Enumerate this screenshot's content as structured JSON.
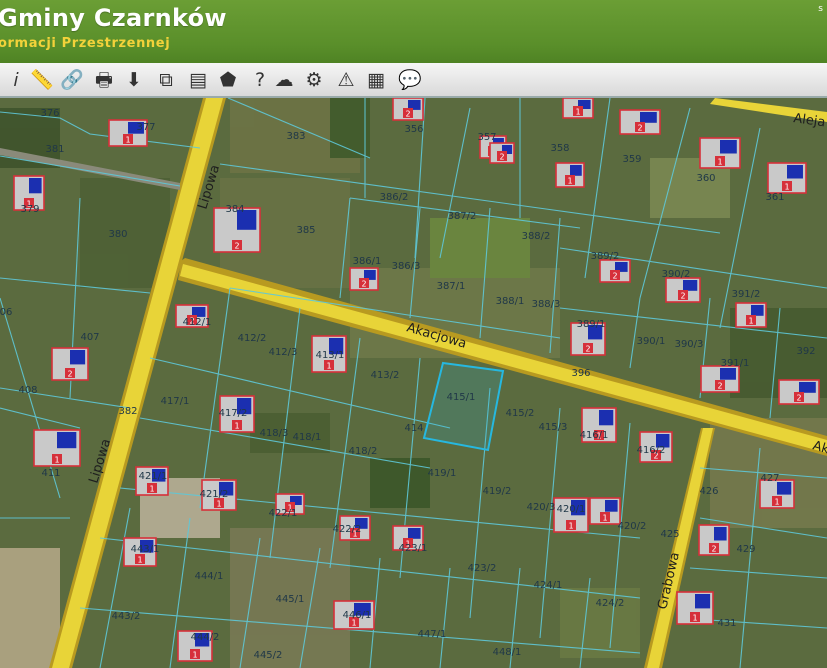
{
  "header": {
    "title": "Gminy Czarnków",
    "subtitle": "ormacji Przestrzennej",
    "corner_text": "s"
  },
  "toolbar": {
    "tools": [
      {
        "name": "info-icon",
        "glyph": "𝑖"
      },
      {
        "name": "measure-icon",
        "glyph": "📏"
      },
      {
        "name": "link-icon",
        "glyph": "🔗"
      },
      {
        "name": "print-icon",
        "glyph": "🖶"
      },
      {
        "name": "download-icon",
        "glyph": "⬇"
      },
      {
        "name": "layers-copy-icon",
        "glyph": "⧉"
      },
      {
        "name": "layout-icon",
        "glyph": "▤"
      },
      {
        "name": "shape-icon",
        "glyph": "⬟"
      },
      {
        "name": "help-icon",
        "glyph": "?"
      },
      {
        "name": "cloud-icon",
        "glyph": "☁"
      },
      {
        "name": "settings-icon",
        "glyph": "⚙"
      },
      {
        "name": "warning-icon",
        "glyph": "⚠"
      },
      {
        "name": "color-grid-icon",
        "glyph": "▦"
      },
      {
        "name": "comment-icon",
        "glyph": "💬"
      }
    ]
  },
  "map": {
    "colors": {
      "road": "#e8d438",
      "road_edge": "#b89a20",
      "parcel_line": "#5fc8d8",
      "selected": "#26b8e0",
      "building": "#d6303a"
    },
    "streets": [
      {
        "name": "Lipowa"
      },
      {
        "name": "Lipowa"
      },
      {
        "name": "Akacjowa"
      },
      {
        "name": "Grabowa"
      },
      {
        "name": "Aleja"
      },
      {
        "name": "Ak"
      }
    ],
    "parcels": [
      "376",
      "377",
      "381",
      "383",
      "356",
      "357",
      "358",
      "359",
      "360",
      "361",
      "379",
      "380",
      "384",
      "385",
      "386/2",
      "387/2",
      "388/2",
      "386/1",
      "386/3",
      "387/1",
      "388/1",
      "388/3",
      "389/2",
      "390/2",
      "391/2",
      "389/1",
      "390/1",
      "390/3",
      "391/1",
      "392",
      "412/1",
      "412/2",
      "412/3",
      "413/1",
      "413/2",
      "407",
      "06",
      "408",
      "396",
      "417/1",
      "417/2",
      "418/3",
      "418/1",
      "418/2",
      "414",
      "415/1",
      "415/2",
      "415/3",
      "416/1",
      "416/2",
      "382",
      "411",
      "419/1",
      "419/2",
      "420/3",
      "420/1",
      "420/2",
      "426",
      "427",
      "421/1",
      "421/2",
      "422/1",
      "422/2",
      "423/1",
      "425",
      "429",
      "443/1",
      "444/1",
      "445/1",
      "446/1",
      "423/2",
      "424/1",
      "424/2",
      "431",
      "443/2",
      "444/2",
      "445/2",
      "447/1",
      "448/1"
    ],
    "building_labels": [
      "1",
      "2",
      "2",
      "1",
      "2",
      "1",
      "1",
      "1",
      "2",
      "2",
      "1",
      "2",
      "2",
      "2",
      "1",
      "2",
      "1",
      "2",
      "2",
      "2",
      "2",
      "1",
      "1",
      "2",
      "1",
      "1",
      "2",
      "1",
      "1",
      "1",
      "1",
      "1",
      "1",
      "1",
      "1",
      "1",
      "1",
      "1"
    ]
  }
}
